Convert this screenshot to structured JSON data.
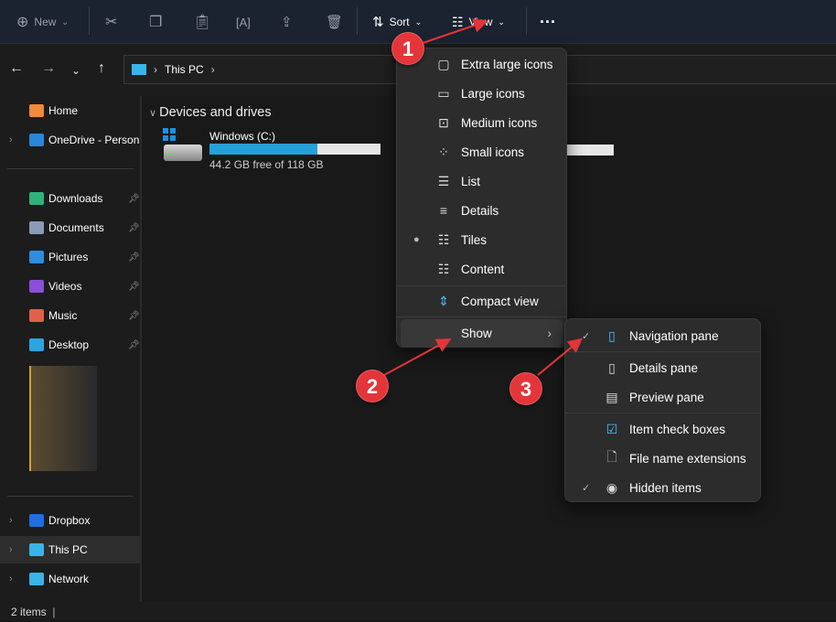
{
  "toolbar": {
    "new": "New",
    "sort": "Sort",
    "view": "View"
  },
  "address": {
    "crumbs": [
      "This PC"
    ]
  },
  "sidebar": {
    "items": [
      {
        "label": "Home",
        "icon": "home-icon",
        "color": "#f08a3c"
      },
      {
        "label": "OneDrive - Personal",
        "icon": "onedrive-icon",
        "color": "#2a86d8"
      },
      {
        "label": "Downloads",
        "icon": "downloads-icon",
        "color": "#2fb37a",
        "pinned": true
      },
      {
        "label": "Documents",
        "icon": "documents-icon",
        "color": "#8a9bb8",
        "pinned": true
      },
      {
        "label": "Pictures",
        "icon": "pictures-icon",
        "color": "#2f8de0",
        "pinned": true
      },
      {
        "label": "Videos",
        "icon": "videos-icon",
        "color": "#8b4fd8",
        "pinned": true
      },
      {
        "label": "Music",
        "icon": "music-icon",
        "color": "#e0604a",
        "pinned": true
      },
      {
        "label": "Desktop",
        "icon": "desktop-icon",
        "color": "#2ba4e0",
        "pinned": true
      },
      {
        "label": "Dropbox",
        "icon": "dropbox-icon",
        "color": "#1f6fe0"
      },
      {
        "label": "This PC",
        "icon": "this-pc-icon",
        "color": "#3ab4e8",
        "selected": true
      },
      {
        "label": "Network",
        "icon": "network-icon",
        "color": "#3ab4e8"
      }
    ]
  },
  "main": {
    "section": "Devices and drives",
    "drives": [
      {
        "name": "Windows (C:)",
        "free": "44.2 GB free of 118 GB",
        "used_fraction": 0.63
      }
    ]
  },
  "view_menu": {
    "items": [
      {
        "label": "Extra large icons",
        "icon": "▢"
      },
      {
        "label": "Large icons",
        "icon": "▭"
      },
      {
        "label": "Medium icons",
        "icon": "⊡"
      },
      {
        "label": "Small icons",
        "icon": "⁘"
      },
      {
        "label": "List",
        "icon": "☰"
      },
      {
        "label": "Details",
        "icon": "≡"
      },
      {
        "label": "Tiles",
        "icon": "☷",
        "selected": true
      },
      {
        "label": "Content",
        "icon": "☷"
      }
    ],
    "compact": "Compact view",
    "show": "Show"
  },
  "show_menu": {
    "items": [
      {
        "label": "Navigation pane",
        "checked": true
      },
      {
        "label": "Details pane"
      },
      {
        "label": "Preview pane"
      },
      {
        "label": "Item check boxes"
      },
      {
        "label": "File name extensions"
      },
      {
        "label": "Hidden items",
        "checked": true
      }
    ]
  },
  "annotations": [
    "1",
    "2",
    "3"
  ],
  "status": {
    "items": "2 items"
  },
  "colors": {
    "accent": "#26a0da",
    "annotation": "#e3353a"
  }
}
